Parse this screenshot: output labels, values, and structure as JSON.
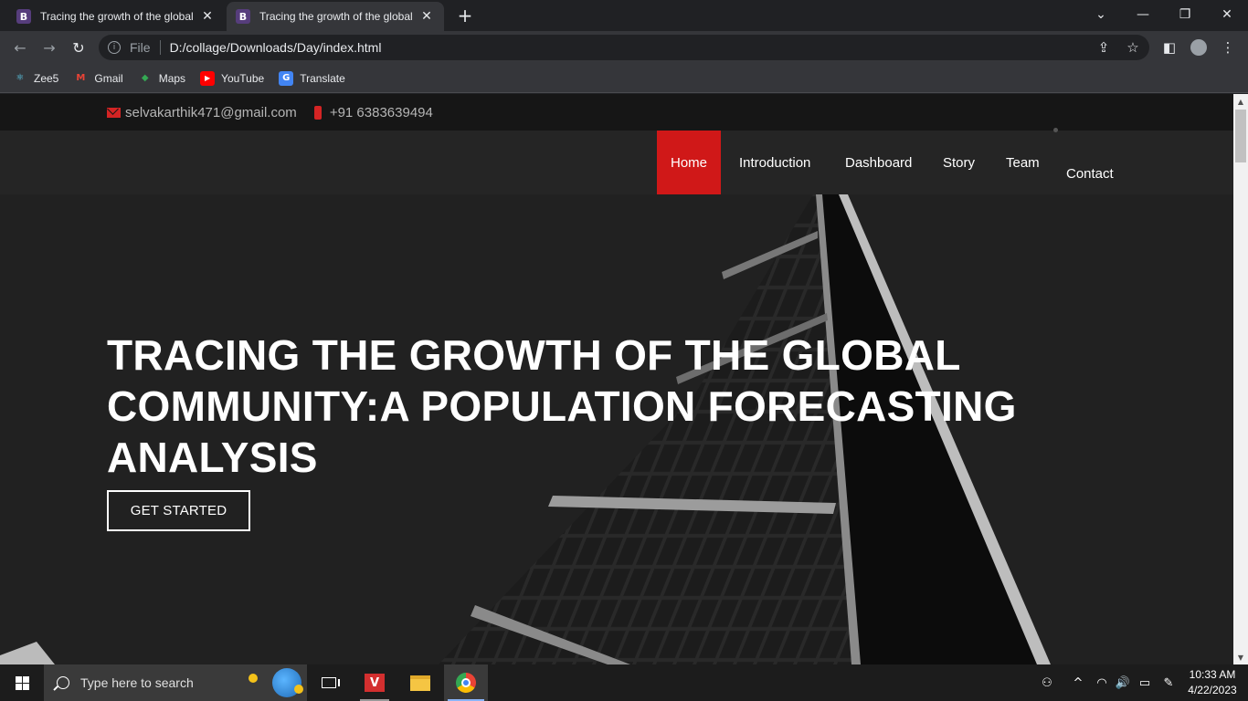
{
  "browser": {
    "tabs": [
      {
        "favicon": "B",
        "title": "Tracing the growth of the global",
        "close": "✕"
      },
      {
        "favicon": "B",
        "title": "Tracing the growth of the global",
        "close": "✕"
      }
    ],
    "new_tab": "+",
    "window_controls": {
      "collapse": "⌄",
      "minimize": "—",
      "restore": "❐",
      "close": "✕"
    },
    "nav": {
      "back": "←",
      "forward": "→",
      "reload": "↻"
    },
    "omnibox": {
      "info": "i",
      "scheme": "File",
      "url": "D:/collage/Downloads/Day/index.html"
    },
    "toolbar_icons": {
      "share": "⇪",
      "star": "☆",
      "sidepanel": "◧",
      "menu": "⋮"
    },
    "bookmarks": [
      {
        "label": "Zee5",
        "icon": "react-icon",
        "color": "#61dafb",
        "glyph": "⚛"
      },
      {
        "label": "Gmail",
        "icon": "gmail-icon",
        "color": "#ea4335",
        "glyph": "M"
      },
      {
        "label": "Maps",
        "icon": "maps-icon",
        "color": "#34a853",
        "glyph": "◆"
      },
      {
        "label": "YouTube",
        "icon": "youtube-icon",
        "color": "#ff0000",
        "glyph": "▶"
      },
      {
        "label": "Translate",
        "icon": "translate-icon",
        "color": "#4285f4",
        "glyph": "G"
      }
    ]
  },
  "page": {
    "topbar": {
      "email": "selvakarthik471@gmail.com",
      "phone": "+91 6383639494"
    },
    "nav": [
      {
        "label": "Home",
        "active": true
      },
      {
        "label": "Introduction"
      },
      {
        "label": "Dashboard"
      },
      {
        "label": "Story"
      },
      {
        "label": "Team"
      },
      {
        "label": "Contact"
      }
    ],
    "hero": {
      "title": "TRACING THE GROWTH OF THE GLOBAL COMMUNITY:A POPULATION FORECASTING ANALYSIS",
      "button": "GET STARTED"
    },
    "colors": {
      "accent": "#d01818",
      "topbar_bg": "#161616",
      "nav_bg": "#252525"
    }
  },
  "scrollbar": {
    "up": "▲",
    "down": "▼"
  },
  "taskbar": {
    "search_placeholder": "Type here to search",
    "tray": {
      "people": "⚇",
      "chevron": "^",
      "wifi": "◠",
      "volume": "🔊",
      "battery": "▭",
      "pen": "✎"
    },
    "clock": {
      "time": "10:33 AM",
      "date": "4/22/2023"
    }
  }
}
